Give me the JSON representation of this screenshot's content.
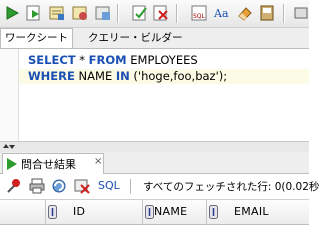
{
  "toolbar": {
    "icons": [
      "run-statement",
      "run-script",
      "explain-plan",
      "autotrace",
      "sql-tuning",
      "commit",
      "rollback",
      "sql-formatter",
      "to-upper-lower",
      "clear",
      "sql-history"
    ]
  },
  "worksheet_tabs": [
    {
      "label": "ワークシート",
      "active": true
    },
    {
      "label": "クエリー・ビルダー",
      "active": false
    }
  ],
  "editor": {
    "line1": {
      "kw1": "SELECT",
      "rest1": " * ",
      "kw2": "FROM",
      "rest2": " EMPLOYEES"
    },
    "line2": {
      "kw1": "WHERE",
      "rest1": " NAME ",
      "kw2": "IN",
      "rest2": " ('hoge,foo,baz');"
    }
  },
  "results": {
    "tab_label": "問合せ結果",
    "close_label": "×",
    "sql_link": "SQL",
    "status": "すべてのフェッチされた行: 0(0.02秒",
    "columns": [
      {
        "label": "ID"
      },
      {
        "label": "NAME"
      },
      {
        "label": "EMAIL"
      }
    ]
  },
  "colors": {
    "keyword": "#1a4fb3",
    "highlight_line": "#fbfbe6",
    "run_green": "#2e9b2e"
  }
}
